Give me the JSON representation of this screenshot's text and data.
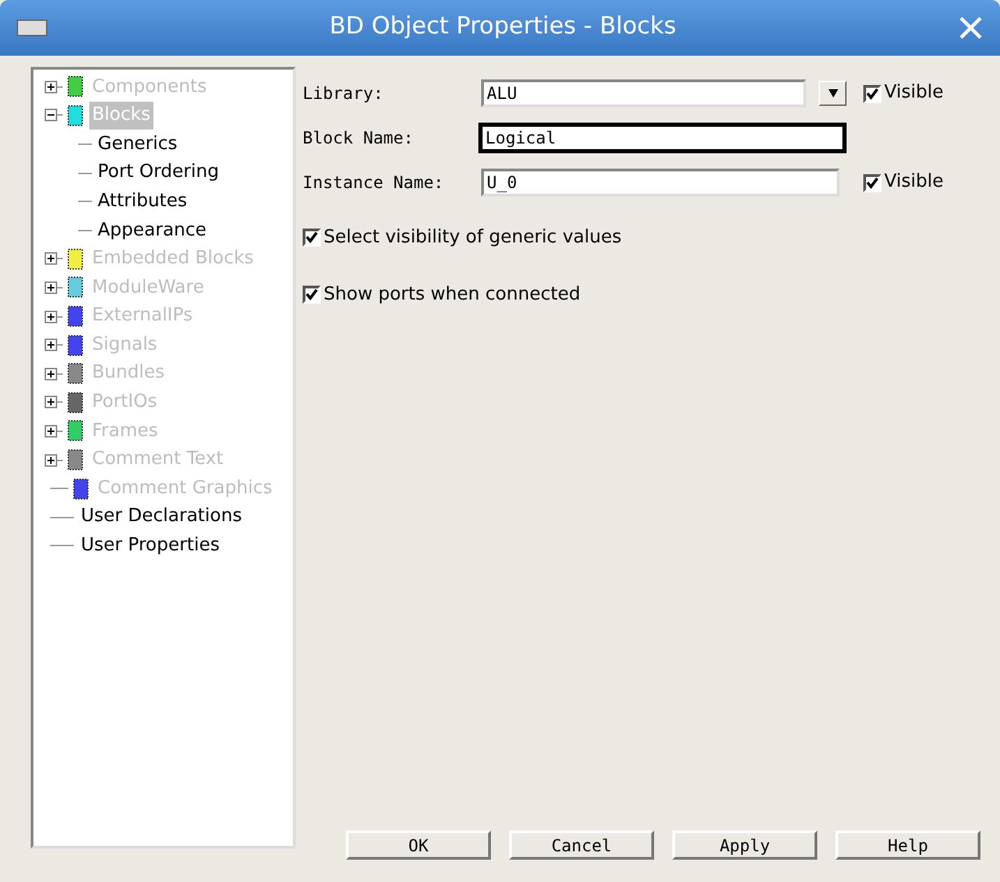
{
  "window": {
    "title": "BD Object Properties - Blocks"
  },
  "tree": [
    {
      "label": "Components",
      "enabled": false,
      "selected": false,
      "expanded": false,
      "color": "#44cc44"
    },
    {
      "label": "Blocks",
      "enabled": false,
      "selected": true,
      "expanded": true,
      "color": "#22dddd",
      "children": [
        {
          "label": "Generics",
          "enabled": true,
          "selected": false
        },
        {
          "label": "Port Ordering",
          "enabled": true,
          "selected": false
        },
        {
          "label": "Attributes",
          "enabled": true,
          "selected": false
        },
        {
          "label": "Appearance",
          "enabled": true,
          "selected": false
        }
      ]
    },
    {
      "label": "Embedded Blocks",
      "enabled": false,
      "selected": false,
      "expanded": false,
      "color": "#eeee44"
    },
    {
      "label": "ModuleWare",
      "enabled": false,
      "selected": false,
      "expanded": false,
      "color": "#66ccdd"
    },
    {
      "label": "ExternalIPs",
      "enabled": false,
      "selected": false,
      "expanded": false,
      "color": "#4444ee"
    },
    {
      "label": "Signals",
      "enabled": false,
      "selected": false,
      "expanded": false,
      "color": "#4444ee"
    },
    {
      "label": "Bundles",
      "enabled": false,
      "selected": false,
      "expanded": false,
      "color": "#888888"
    },
    {
      "label": "PortIOs",
      "enabled": false,
      "selected": false,
      "expanded": false,
      "color": "#666666"
    },
    {
      "label": "Frames",
      "enabled": false,
      "selected": false,
      "expanded": false,
      "color": "#33cc66"
    },
    {
      "label": "Comment Text",
      "enabled": false,
      "selected": false,
      "expanded": false,
      "color": "#888888"
    },
    {
      "label": "Comment Graphics",
      "enabled": false,
      "selected": false,
      "color": "#4444ee"
    },
    {
      "label": "User Declarations",
      "enabled": true,
      "selected": false
    },
    {
      "label": "User Properties",
      "enabled": true,
      "selected": false
    }
  ],
  "form": {
    "library": {
      "label": "Library:",
      "value": "ALU",
      "visible_label": "Visible",
      "visible_checked": true
    },
    "block_name": {
      "label": "Block Name:",
      "value": "Logical"
    },
    "instance_name": {
      "label": "Instance Name:",
      "value": "U_0",
      "visible_label": "Visible",
      "visible_checked": true
    },
    "options": [
      {
        "label": "Select visibility of generic values",
        "checked": true
      },
      {
        "label": "Show ports when connected",
        "checked": true
      }
    ]
  },
  "buttons": [
    "OK",
    "Cancel",
    "Apply",
    "Help"
  ]
}
